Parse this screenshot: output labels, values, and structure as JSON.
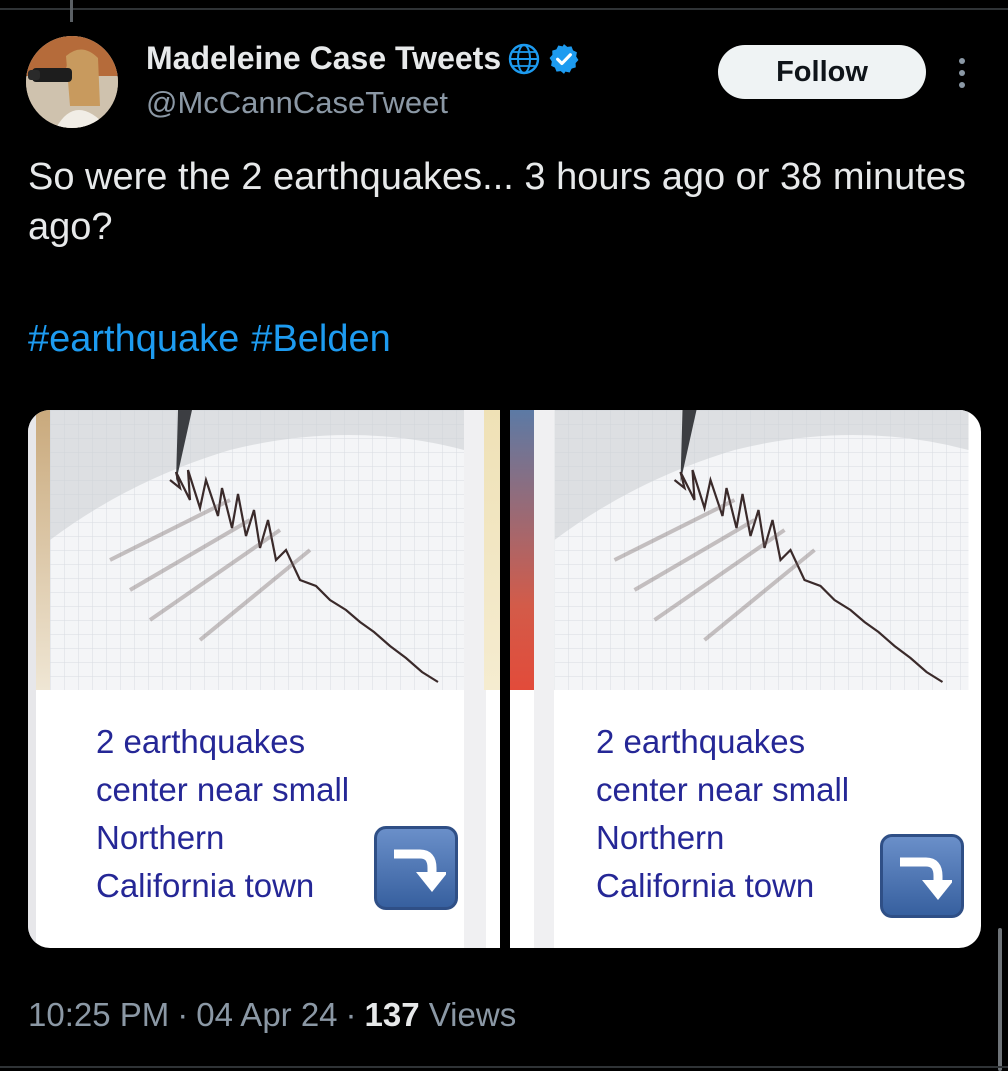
{
  "author": {
    "display_name": "Madeleine Case Tweets",
    "handle": "@McCannCaseTweet",
    "verified": true,
    "icons": [
      "globe-icon",
      "verified-badge-icon"
    ]
  },
  "actions": {
    "follow_label": "Follow",
    "more_icon": "more-dots-icon"
  },
  "tweet": {
    "text": "So were the 2 earthquakes... 3 hours ago or 38 minutes ago?",
    "hashtags": [
      "#earthquake",
      "#Belden"
    ]
  },
  "media": [
    {
      "caption": [
        "2 earthquakes",
        "center near small",
        "Northern",
        "California town"
      ],
      "icon": "arrow-curving-down-icon"
    },
    {
      "caption": [
        "2 earthquakes",
        "center near small",
        "Northern",
        "California town"
      ],
      "icon": "arrow-curving-down-icon"
    }
  ],
  "footer": {
    "time": "10:25 PM",
    "separator": "·",
    "date": "04 Apr 24",
    "views_count": "137",
    "views_label": "Views"
  },
  "colors": {
    "background": "#000000",
    "text": "#e7e9ea",
    "secondary": "#8b98a5",
    "link": "#1d9bf0",
    "verified": "#1d9bf0",
    "caption": "#252796"
  }
}
